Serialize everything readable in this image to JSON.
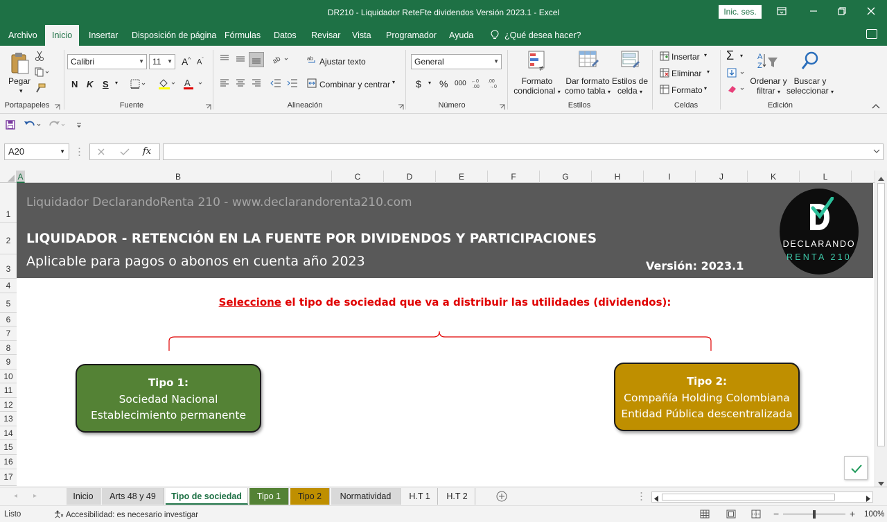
{
  "window": {
    "title": "DR210 - Liquidador ReteFte dividendos Versión 2023.1  -  Excel",
    "signin_label": "Inic. ses."
  },
  "menu": {
    "tabs": [
      "Archivo",
      "Inicio",
      "Insertar",
      "Disposición de página",
      "Fórmulas",
      "Datos",
      "Revisar",
      "Vista",
      "Programador",
      "Ayuda"
    ],
    "active_tab": "Inicio",
    "tell_me": "¿Qué desea hacer?"
  },
  "ribbon": {
    "clipboard": {
      "paste_label": "Pegar",
      "group": "Portapapeles"
    },
    "font": {
      "name": "Calibri",
      "size": "11",
      "bold": "N",
      "italic": "K",
      "underline": "S",
      "group": "Fuente"
    },
    "alignment": {
      "wrap_text": "Ajustar texto",
      "merge_center": "Combinar y centrar",
      "group": "Alineación"
    },
    "number": {
      "format": "General",
      "currency": "$",
      "percent": "%",
      "thousands": "000",
      "group": "Número"
    },
    "styles": {
      "conditional_line1": "Formato",
      "conditional_line2": "condicional",
      "as_table_line1": "Dar formato",
      "as_table_line2": "como tabla",
      "cell_styles_line1": "Estilos de",
      "cell_styles_line2": "celda",
      "group": "Estilos"
    },
    "cells": {
      "insert": "Insertar",
      "delete": "Eliminar",
      "format": "Formato",
      "group": "Celdas"
    },
    "editing": {
      "sort_line1": "Ordenar y",
      "sort_line2": "filtrar",
      "find_line1": "Buscar y",
      "find_line2": "seleccionar",
      "group": "Edición"
    }
  },
  "formula_bar": {
    "name_box": "A20",
    "fx": "fx",
    "value": ""
  },
  "columns": [
    "A",
    "B",
    "C",
    "D",
    "E",
    "F",
    "G",
    "H",
    "I",
    "J",
    "K",
    "L"
  ],
  "rows": [
    "1",
    "2",
    "3",
    "4",
    "5",
    "6",
    "7",
    "8",
    "9",
    "10",
    "11",
    "12",
    "13",
    "14",
    "15",
    "16",
    "17"
  ],
  "sheet": {
    "site_line": "Liquidador DeclarandoRenta 210 - www.declarandorenta210.com",
    "main_title": "LIQUIDADOR - RETENCIÓN EN LA FUENTE POR DIVIDENDOS Y PARTICIPACIONES",
    "subtitle": "Aplicable para pagos o abonos en cuenta año 2023",
    "version": "Versión: 2023.1",
    "logo_line1": "DECLARANDO",
    "logo_line2": "RENTA 210",
    "prompt_underlined": "Seleccione",
    "prompt_rest": " el tipo de sociedad que va a distribuir las utilidades (dividendos):",
    "type1": {
      "title": "Tipo 1:",
      "line1": "Sociedad Nacional",
      "line2": "Establecimiento permanente",
      "color": "#548235"
    },
    "type2": {
      "title": "Tipo 2:",
      "line1": "Compañía Holding Colombiana",
      "line2": "Entidad Pública descentralizada",
      "color": "#bf8f00"
    }
  },
  "sheet_tabs": {
    "items": [
      "Inicio",
      "Arts 48 y 49",
      "Tipo de sociedad",
      "Tipo 1",
      "Tipo 2",
      "Normatividad",
      "H.T 1",
      "H.T 2"
    ],
    "active": "Tipo de sociedad"
  },
  "status": {
    "ready": "Listo",
    "accessibility": "Accesibilidad: es necesario investigar",
    "zoom": "100%"
  }
}
